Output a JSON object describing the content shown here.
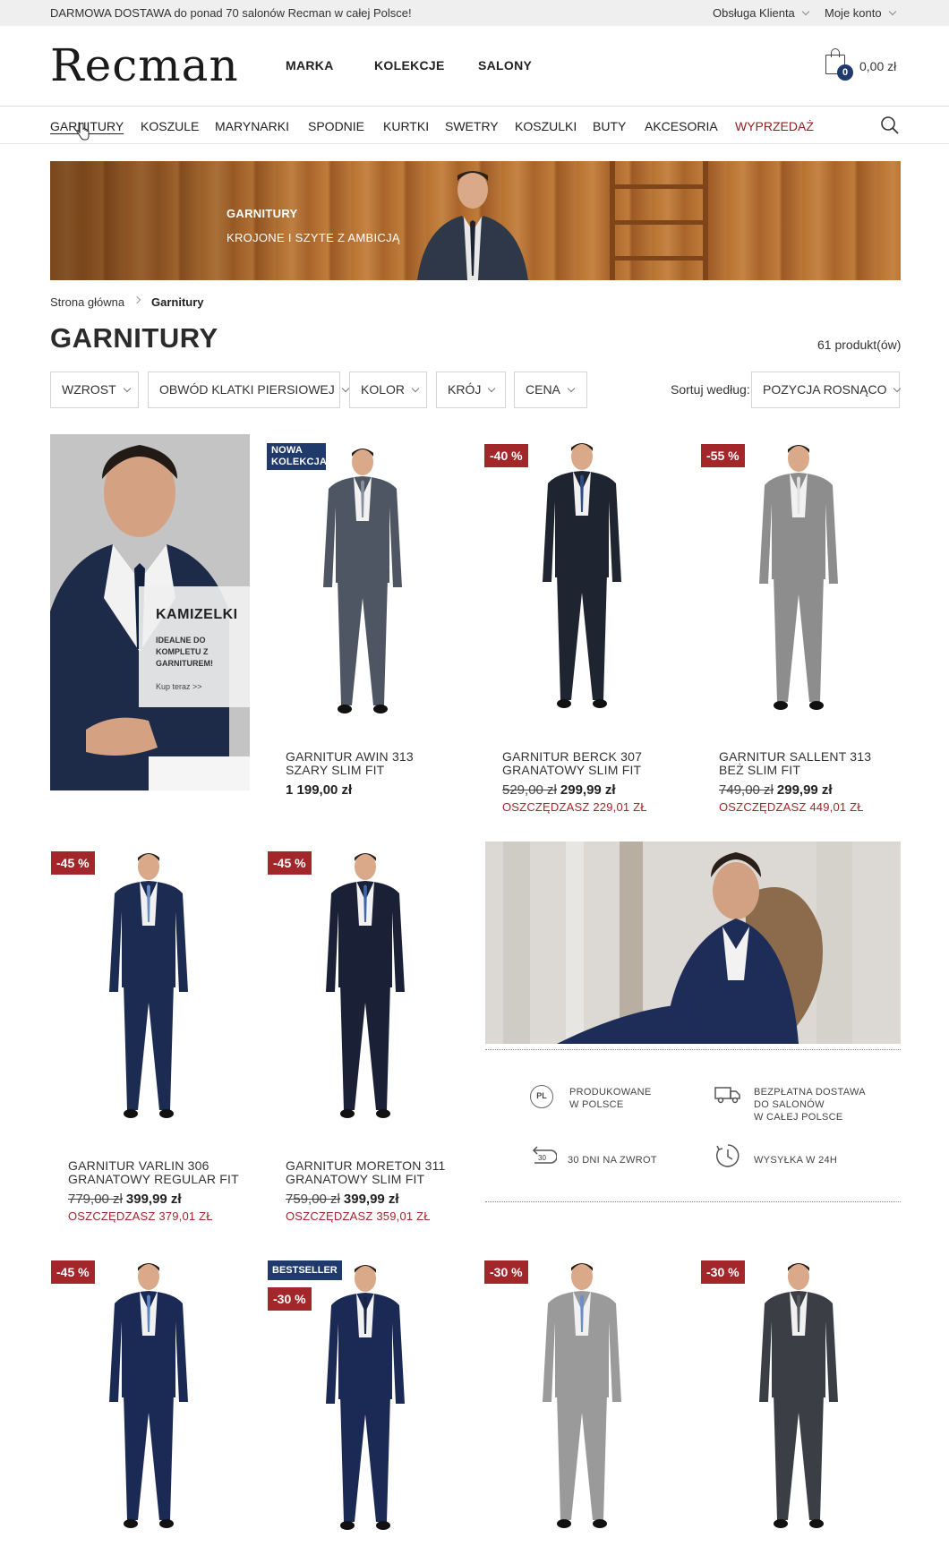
{
  "topbar": {
    "promo": "DARMOWA DOSTAWA do ponad 70 salonów Recman w całej Polsce!",
    "customer_service": "Obsługa Klienta",
    "account": "Moje konto"
  },
  "header": {
    "logo": "Recman",
    "nav": [
      "MARKA",
      "KOLEKCJE",
      "SALONY"
    ],
    "cart_count": "0",
    "cart_total": "0,00 zł"
  },
  "categories": [
    "GARNITURY",
    "KOSZULE",
    "MARYNARKI",
    "SPODNIE",
    "KURTKI",
    "SWETRY",
    "KOSZULKI",
    "BUTY",
    "AKCESORIA",
    "WYPRZEDAŻ"
  ],
  "banner": {
    "title": "GARNITURY",
    "subtitle": "KROJONE I SZYTE Z AMBICJĄ"
  },
  "breadcrumb": {
    "home": "Strona główna",
    "current": "Garnitury"
  },
  "page": {
    "title": "GARNITURY",
    "count": "61 produkt(ów)"
  },
  "filters": [
    "WZROST",
    "OBWÓD KLATKI PIERSIOWEJ",
    "KOLOR",
    "KRÓJ",
    "CENA"
  ],
  "sort": {
    "label": "Sortuj według:",
    "value": "POZYCJA ROSNĄCO"
  },
  "promo_card": {
    "title": "KAMIZELKI",
    "text": "IDEALNE DO KOMPLETU Z GARNITUREM!",
    "link": "Kup teraz >>"
  },
  "products": [
    {
      "badge": "NOWA KOLEKCJA",
      "name1": "GARNITUR AWIN 313",
      "name2": "SZARY SLIM FIT",
      "old_price": "",
      "price": "1 199,00 zł",
      "save": ""
    },
    {
      "badge": "-40 %",
      "name1": "GARNITUR BERCK 307",
      "name2": "GRANATOWY SLIM FIT",
      "old_price": "529,00 zł",
      "price": "299,99 zł",
      "save": "OSZCZĘDZASZ 229,01 ZŁ"
    },
    {
      "badge": "-55 %",
      "name1": "GARNITUR SALLENT 313",
      "name2": "BEŻ SLIM FIT",
      "old_price": "749,00 zł",
      "price": "299,99 zł",
      "save": "OSZCZĘDZASZ 449,01 ZŁ"
    },
    {
      "badge": "-45 %",
      "name1": "GARNITUR VARLIN 306",
      "name2": "GRANATOWY REGULAR FIT",
      "old_price": "779,00 zł",
      "price": "399,99 zł",
      "save": "OSZCZĘDZASZ 379,01 ZŁ"
    },
    {
      "badge": "-45 %",
      "name1": "GARNITUR MORETON 311",
      "name2": "GRANATOWY SLIM FIT",
      "old_price": "759,00 zł",
      "price": "399,99 zł",
      "save": "OSZCZĘDZASZ 359,01 ZŁ"
    },
    {
      "badge": "-45 %"
    },
    {
      "badge_top": "BESTSELLER",
      "badge": "-30 %"
    },
    {
      "badge": "-30 %"
    },
    {
      "badge": "-30 %"
    }
  ],
  "features": [
    {
      "icon": "PL",
      "text1": "PRODUKOWANE",
      "text2": "W POLSCE",
      "text3": ""
    },
    {
      "icon": "truck-icon",
      "text1": "BEZPŁATNA DOSTAWA",
      "text2": "DO SALONÓW",
      "text3": "W CAŁEJ POLSCE"
    },
    {
      "icon": "30",
      "text1": "30 DNI NA ZWROT",
      "text2": "",
      "text3": ""
    },
    {
      "icon": "clock-icon",
      "text1": "WYSYŁKA W 24H",
      "text2": "",
      "text3": ""
    }
  ],
  "colors": {
    "accent_red": "#a3262a",
    "navy": "#1f3a6b",
    "sale": "#9b1b22"
  }
}
